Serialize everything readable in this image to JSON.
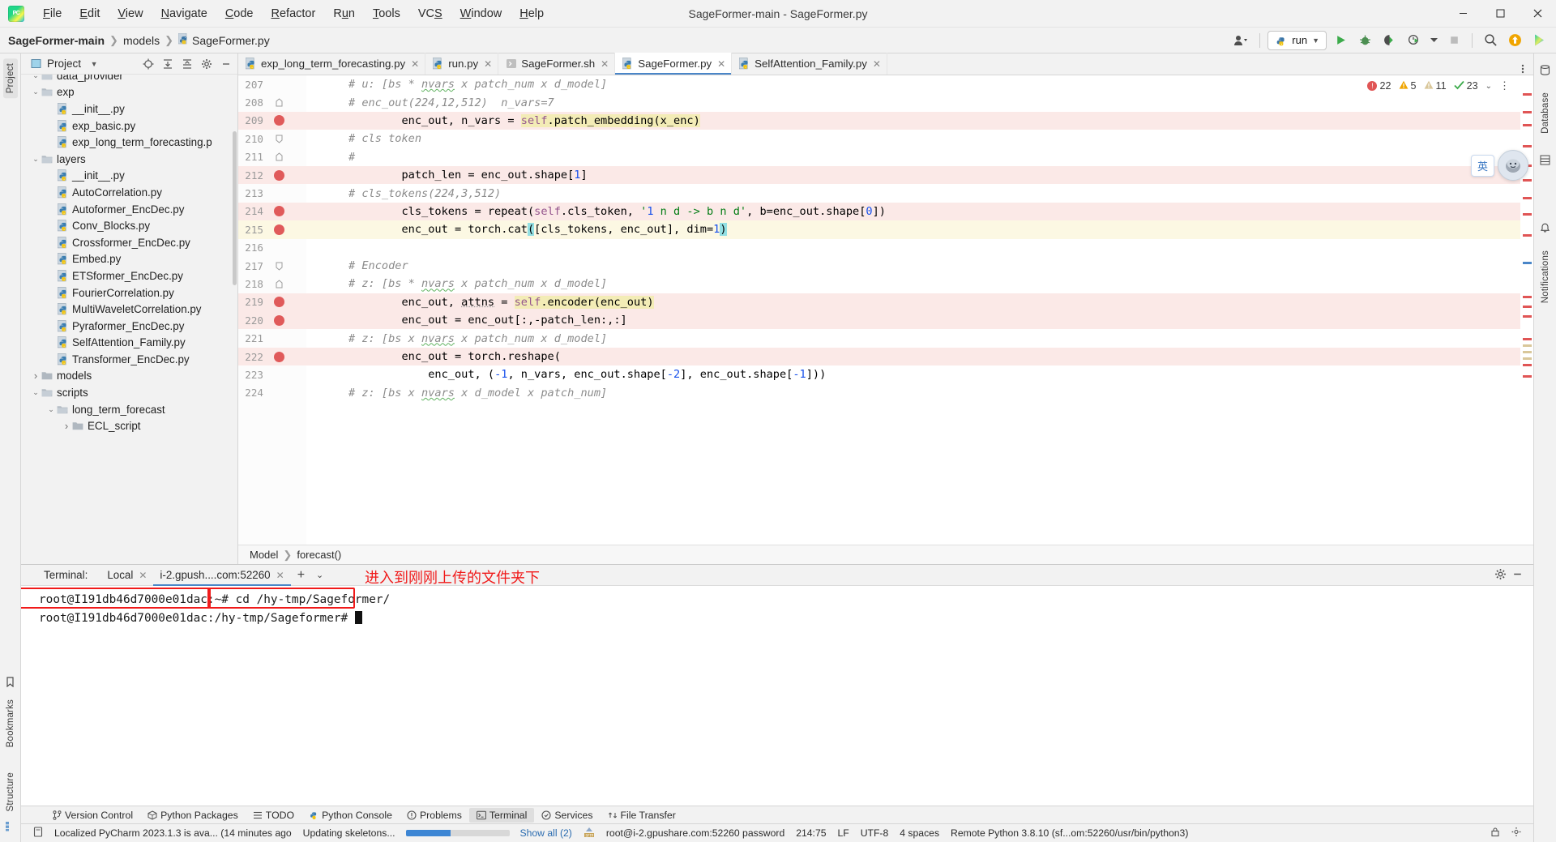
{
  "window": {
    "title": "SageFormer-main - SageFormer.py",
    "minimize": "—",
    "maximize": "▢",
    "close": "✕"
  },
  "menu": {
    "items": [
      "File",
      "Edit",
      "View",
      "Navigate",
      "Code",
      "Refactor",
      "Run",
      "Tools",
      "VCS",
      "Window",
      "Help"
    ]
  },
  "navbar": {
    "breadcrumb": [
      "SageFormer-main",
      "models",
      "SageFormer.py"
    ],
    "run_config": "run",
    "icons": [
      "user-icon",
      "run-icon",
      "debug-icon",
      "coverage-icon",
      "profile-icon",
      "stop-icon",
      "search-icon",
      "update-icon",
      "ai-assistant-icon",
      "more-icon"
    ]
  },
  "left_strip": {
    "tabs": [
      "Project",
      "Bookmarks",
      "Structure"
    ]
  },
  "right_strip": {
    "tabs": [
      "Database",
      "Notifications"
    ]
  },
  "project": {
    "header_title": "Project",
    "tree": [
      {
        "label": "data_provider",
        "depth": 2,
        "type": "folder",
        "twist": "down",
        "clipped": true
      },
      {
        "label": "exp",
        "depth": 2,
        "type": "folder",
        "twist": "down"
      },
      {
        "label": "__init__.py",
        "depth": 3,
        "type": "python"
      },
      {
        "label": "exp_basic.py",
        "depth": 3,
        "type": "python"
      },
      {
        "label": "exp_long_term_forecasting.p",
        "depth": 3,
        "type": "python"
      },
      {
        "label": "layers",
        "depth": 2,
        "type": "folder",
        "twist": "down"
      },
      {
        "label": "__init__.py",
        "depth": 3,
        "type": "python"
      },
      {
        "label": "AutoCorrelation.py",
        "depth": 3,
        "type": "python"
      },
      {
        "label": "Autoformer_EncDec.py",
        "depth": 3,
        "type": "python"
      },
      {
        "label": "Conv_Blocks.py",
        "depth": 3,
        "type": "python"
      },
      {
        "label": "Crossformer_EncDec.py",
        "depth": 3,
        "type": "python"
      },
      {
        "label": "Embed.py",
        "depth": 3,
        "type": "python"
      },
      {
        "label": "ETSformer_EncDec.py",
        "depth": 3,
        "type": "python"
      },
      {
        "label": "FourierCorrelation.py",
        "depth": 3,
        "type": "python"
      },
      {
        "label": "MultiWaveletCorrelation.py",
        "depth": 3,
        "type": "python"
      },
      {
        "label": "Pyraformer_EncDec.py",
        "depth": 3,
        "type": "python"
      },
      {
        "label": "SelfAttention_Family.py",
        "depth": 3,
        "type": "python"
      },
      {
        "label": "Transformer_EncDec.py",
        "depth": 3,
        "type": "python"
      },
      {
        "label": "models",
        "depth": 2,
        "type": "folder",
        "twist": "right"
      },
      {
        "label": "scripts",
        "depth": 2,
        "type": "folder",
        "twist": "down"
      },
      {
        "label": "long_term_forecast",
        "depth": 3,
        "type": "folder",
        "twist": "down"
      },
      {
        "label": "ECL_script",
        "depth": 4,
        "type": "folder",
        "twist": "right",
        "clipped": true
      }
    ]
  },
  "editor": {
    "tabs": [
      {
        "label": "exp_long_term_forecasting.py",
        "icon": "python-file-icon",
        "active": false
      },
      {
        "label": "run.py",
        "icon": "python-file-icon",
        "active": false
      },
      {
        "label": "SageFormer.sh",
        "icon": "shell-file-icon",
        "active": false
      },
      {
        "label": "SageFormer.py",
        "icon": "python-file-icon",
        "active": true
      },
      {
        "label": "SelfAttention_Family.py",
        "icon": "python-file-icon",
        "active": false
      }
    ],
    "inspections": {
      "errors": "22",
      "warnings": "5",
      "weak_warnings": "11",
      "checked": "23"
    },
    "breadcrumb": [
      "Model",
      "forecast()"
    ],
    "lines": [
      {
        "num": "207",
        "bp": false,
        "fold": "",
        "hl": "",
        "text": "        # u: [bs * nvars x patch_num x d_model]"
      },
      {
        "num": "208",
        "bp": false,
        "fold": "up",
        "hl": "",
        "text": "        # enc_out(224,12,512)  n_vars=7"
      },
      {
        "num": "209",
        "bp": true,
        "fold": "",
        "hl": "pink",
        "text": "        enc_out, n_vars = self.patch_embedding(x_enc)"
      },
      {
        "num": "210",
        "bp": false,
        "fold": "down",
        "hl": "",
        "text": "        # cls token"
      },
      {
        "num": "211",
        "bp": false,
        "fold": "up",
        "hl": "",
        "text": "        #"
      },
      {
        "num": "212",
        "bp": true,
        "fold": "",
        "hl": "pink",
        "text": "        patch_len = enc_out.shape[1]"
      },
      {
        "num": "213",
        "bp": false,
        "fold": "",
        "hl": "",
        "text": "        # cls_tokens(224,3,512)"
      },
      {
        "num": "214",
        "bp": true,
        "fold": "",
        "hl": "pink",
        "text": "        cls_tokens = repeat(self.cls_token, '1 n d -> b n d', b=enc_out.shape[0])"
      },
      {
        "num": "215",
        "bp": true,
        "fold": "",
        "hl": "yellow",
        "text": "        enc_out = torch.cat([cls_tokens, enc_out], dim=1)"
      },
      {
        "num": "216",
        "bp": false,
        "fold": "",
        "hl": "",
        "text": ""
      },
      {
        "num": "217",
        "bp": false,
        "fold": "down",
        "hl": "",
        "text": "        # Encoder"
      },
      {
        "num": "218",
        "bp": false,
        "fold": "up",
        "hl": "",
        "text": "        # z: [bs * nvars x patch_num x d_model]"
      },
      {
        "num": "219",
        "bp": true,
        "fold": "",
        "hl": "pink",
        "text": "        enc_out, attns = self.encoder(enc_out)"
      },
      {
        "num": "220",
        "bp": true,
        "fold": "",
        "hl": "pink",
        "text": "        enc_out = enc_out[:,-patch_len:,:]"
      },
      {
        "num": "221",
        "bp": false,
        "fold": "",
        "hl": "",
        "text": "        # z: [bs x nvars x patch_num x d_model]"
      },
      {
        "num": "222",
        "bp": true,
        "fold": "",
        "hl": "pink",
        "text": "        enc_out = torch.reshape("
      },
      {
        "num": "223",
        "bp": false,
        "fold": "",
        "hl": "",
        "text": "            enc_out, (-1, n_vars, enc_out.shape[-2], enc_out.shape[-1]))"
      },
      {
        "num": "224",
        "bp": false,
        "fold": "",
        "hl": "",
        "text": "        # z: [bs x nvars x d_model x patch_num]"
      }
    ]
  },
  "ai_widget": {
    "lang_badge": "英",
    "avatar": "assistant-avatar"
  },
  "terminal": {
    "label": "Terminal:",
    "tabs": [
      {
        "label": "Local",
        "active": false
      },
      {
        "label": "i-2.gpush....com:52260",
        "active": true
      }
    ],
    "add": "+",
    "chevron": "⌄",
    "settings_icon": "gear-icon",
    "minimize_icon": "minimize-icon",
    "lines": [
      {
        "prompt": "root@I191db46d7000e01dac",
        "sep": ":~# ",
        "command": "cd /hy-tmp/Sageformer/"
      },
      {
        "prompt": "root@I191db46d7000e01dac:/hy-tmp/Sageformer#",
        "sep": " ",
        "command": ""
      }
    ]
  },
  "annotation": {
    "text": "进入到刚刚上传的文件夹下",
    "color": "#f01a1a"
  },
  "tool_windows": [
    {
      "label": "Version Control",
      "icon": "branch-icon",
      "active": false
    },
    {
      "label": "Python Packages",
      "icon": "package-icon",
      "active": false
    },
    {
      "label": "TODO",
      "icon": "list-icon",
      "active": false
    },
    {
      "label": "Python Console",
      "icon": "python-icon",
      "active": false
    },
    {
      "label": "Problems",
      "icon": "warning-icon",
      "active": false
    },
    {
      "label": "Terminal",
      "icon": "terminal-icon",
      "active": true
    },
    {
      "label": "Services",
      "icon": "services-icon",
      "active": false
    },
    {
      "label": "File Transfer",
      "icon": "transfer-icon",
      "active": false
    }
  ],
  "status_bar": {
    "message": "Localized PyCharm 2023.1.3 is ava... (14 minutes ago",
    "task": "Updating skeletons...",
    "show_all": "Show all (2)",
    "sftp": "root@i-2.gpushare.com:52260 password",
    "caret": "214:75",
    "line_sep": "LF",
    "encoding": "UTF-8",
    "indent": "4 spaces",
    "interpreter": "Remote Python 3.8.10 (sf...om:52260/usr/bin/python3)",
    "progress_pct": 43
  },
  "colors": {
    "accent": "#4a86c8",
    "annotation_red": "#f01a1a",
    "breakpoint": "#e05a5a",
    "highlight_pink": "#fbe9e7",
    "highlight_yellow": "#fcf8e3"
  }
}
